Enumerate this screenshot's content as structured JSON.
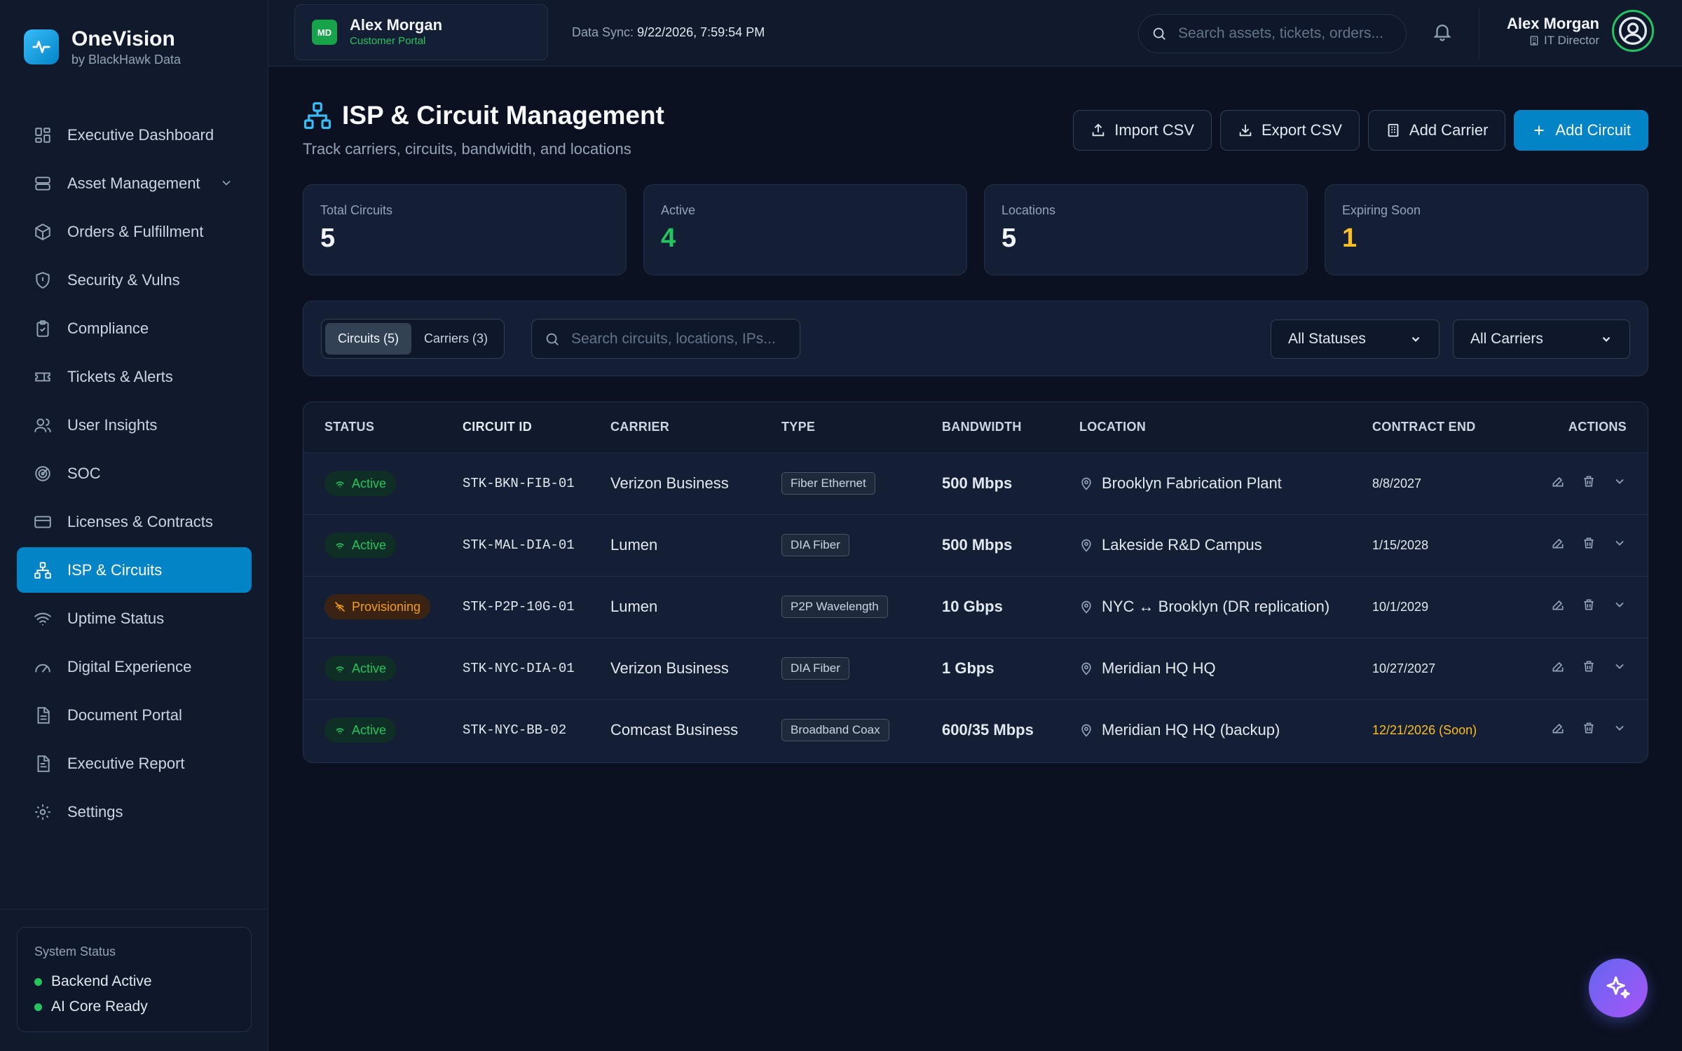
{
  "brand": {
    "name": "OneVision",
    "sub": "by BlackHawk Data",
    "icon": "pulse-icon"
  },
  "sidebar": {
    "items": [
      {
        "label": "Executive Dashboard",
        "icon": "dashboard-icon"
      },
      {
        "label": "Asset Management",
        "icon": "server-icon"
      },
      {
        "label": "Orders & Fulfillment",
        "icon": "package-icon"
      },
      {
        "label": "Security & Vulns",
        "icon": "shield-icon"
      },
      {
        "label": "Compliance",
        "icon": "clipboard-icon"
      },
      {
        "label": "Tickets & Alerts",
        "icon": "ticket-icon"
      },
      {
        "label": "User Insights",
        "icon": "users-icon"
      },
      {
        "label": "SOC",
        "icon": "radar-icon"
      },
      {
        "label": "Licenses & Contracts",
        "icon": "card-icon"
      },
      {
        "label": "ISP & Circuits",
        "icon": "network-icon"
      },
      {
        "label": "Uptime Status",
        "icon": "wifi-icon"
      },
      {
        "label": "Digital Experience",
        "icon": "gauge-icon"
      },
      {
        "label": "Document Portal",
        "icon": "document-icon"
      },
      {
        "label": "Executive Report",
        "icon": "report-icon"
      },
      {
        "label": "Settings",
        "icon": "gear-icon"
      }
    ],
    "active": "ISP & Circuits"
  },
  "system_status": {
    "title": "System Status",
    "lines": [
      "Backend Active",
      "AI Core Ready"
    ]
  },
  "tenant": {
    "badge": "MD",
    "name": "Alex Morgan",
    "sub": "Customer Portal"
  },
  "sync": {
    "label": "Data Sync:",
    "value": "9/22/2026, 7:59:54 PM"
  },
  "top_search": {
    "placeholder": "Search assets, tickets, orders..."
  },
  "user": {
    "name": "Alex Morgan",
    "role": "IT Director"
  },
  "page": {
    "title": "ISP & Circuit Management",
    "subtitle": "Track carriers, circuits, bandwidth, and locations"
  },
  "actions": {
    "import": "Import CSV",
    "export": "Export CSV",
    "add_carrier": "Add Carrier",
    "add_circuit": "Add Circuit"
  },
  "stats": [
    {
      "label": "Total Circuits",
      "value": "5"
    },
    {
      "label": "Active",
      "value": "4"
    },
    {
      "label": "Locations",
      "value": "5"
    },
    {
      "label": "Expiring Soon",
      "value": "1"
    }
  ],
  "filters": {
    "tab_circuits": "Circuits (5)",
    "tab_carriers": "Carriers (3)",
    "search_placeholder": "Search circuits, locations, IPs...",
    "status_select": "All Statuses",
    "carrier_select": "All Carriers"
  },
  "table": {
    "headers": {
      "status": "STATUS",
      "id": "CIRCUIT ID",
      "carrier": "CARRIER",
      "type": "TYPE",
      "bandwidth": "BANDWIDTH",
      "location": "LOCATION",
      "end": "CONTRACT END",
      "actions": "ACTIONS"
    },
    "rows": [
      {
        "status": "Active",
        "id": "STK-BKN-FIB-01",
        "carrier": "Verizon Business",
        "type": "Fiber Ethernet",
        "bandwidth": "500 Mbps",
        "location": "Brooklyn Fabrication Plant",
        "end": "8/8/2027"
      },
      {
        "status": "Active",
        "id": "STK-MAL-DIA-01",
        "carrier": "Lumen",
        "type": "DIA Fiber",
        "bandwidth": "500 Mbps",
        "location": "Lakeside R&D Campus",
        "end": "1/15/2028"
      },
      {
        "status": "Provisioning",
        "id": "STK-P2P-10G-01",
        "carrier": "Lumen",
        "type": "P2P Wavelength",
        "bandwidth": "10 Gbps",
        "location": "NYC ↔ Brooklyn (DR replication)",
        "end": "10/1/2029"
      },
      {
        "status": "Active",
        "id": "STK-NYC-DIA-01",
        "carrier": "Verizon Business",
        "type": "DIA Fiber",
        "bandwidth": "1 Gbps",
        "location": "Meridian HQ HQ",
        "end": "10/27/2027"
      },
      {
        "status": "Active",
        "id": "STK-NYC-BB-02",
        "carrier": "Comcast Business",
        "type": "Broadband Coax",
        "bandwidth": "600/35 Mbps",
        "location": "Meridian HQ HQ (backup)",
        "end": "12/21/2026 (Soon)"
      }
    ]
  },
  "colors": {
    "accent": "#0284c7",
    "active": "#22c55e",
    "warning": "#f59e0b",
    "soon": "#fbbf24"
  }
}
